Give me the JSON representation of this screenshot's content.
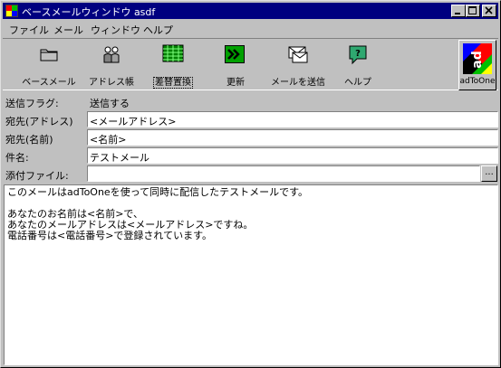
{
  "window": {
    "title": "ベースメールウィンドウ asdf",
    "minimize_label": "_",
    "maximize_label": "□",
    "close_label": "×"
  },
  "menu": [
    "ファイル",
    "メール",
    "ウィンドウ",
    "ヘルプ"
  ],
  "toolbar": {
    "items": [
      {
        "label": "ベースメール",
        "icon": "folder-icon"
      },
      {
        "label": "アドレス帳",
        "icon": "people-icon"
      },
      {
        "label": "差替置換",
        "icon": "grid-icon"
      },
      {
        "label": "更新",
        "icon": "arrow-refresh-icon"
      },
      {
        "label": "メールを送信",
        "icon": "envelope-icon"
      },
      {
        "label": "ヘルプ",
        "icon": "help-icon"
      }
    ],
    "brand": {
      "label": "adToOne",
      "logo_text": "ad"
    }
  },
  "form": {
    "send_flag": {
      "label": "送信フラグ:",
      "value": "送信する"
    },
    "to_address": {
      "label": "宛先(アドレス)",
      "value": "<メールアドレス>"
    },
    "to_name": {
      "label": "宛先(名前)",
      "value": "<名前>"
    },
    "subject": {
      "label": "件名:",
      "value": "テストメール"
    },
    "attachment": {
      "label": "添付ファイル:",
      "value": "",
      "browse_label": "..."
    }
  },
  "body": {
    "lines": [
      "このメールはadToOneを使って同時に配信したテストメールです。",
      "",
      "あなたのお名前は<名前>で、",
      "あなたのメールアドレスは<メールアドレス>ですね。",
      "電話番号は<電話番号>で登録されています。"
    ]
  },
  "colors": {
    "titlebar": "#000080",
    "face": "#c0c0c0",
    "accent_green": "#00a000",
    "help_green": "#2fa870"
  }
}
